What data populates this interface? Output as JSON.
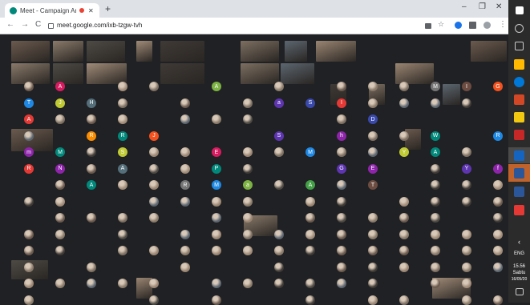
{
  "browser": {
    "tab_title": "Meet - Campaign Ambassad",
    "url": "meet.google.com/ixb-tzgw-tvh"
  },
  "participants": {
    "letters": [
      "A",
      "A",
      "M",
      "I",
      "G",
      "T",
      "J",
      "H",
      "a",
      "S",
      "I",
      "A",
      "D",
      "R",
      "R",
      "J",
      "S",
      "h",
      "W",
      "R",
      "m",
      "M",
      "S",
      "E",
      "M",
      "Y",
      "A",
      "R",
      "N",
      "A",
      "P",
      "G",
      "E",
      "Y",
      "f",
      "A",
      "R",
      "M",
      "a",
      "A",
      "T"
    ]
  },
  "taskbar": {
    "lang": "ENG",
    "time": "15.56",
    "day": "Sabtu",
    "date": "16/05/20"
  },
  "colors": {
    "tabbar": "#dee1e6",
    "meet_bg": "#202124",
    "taskbar": "#2b2b2b"
  }
}
